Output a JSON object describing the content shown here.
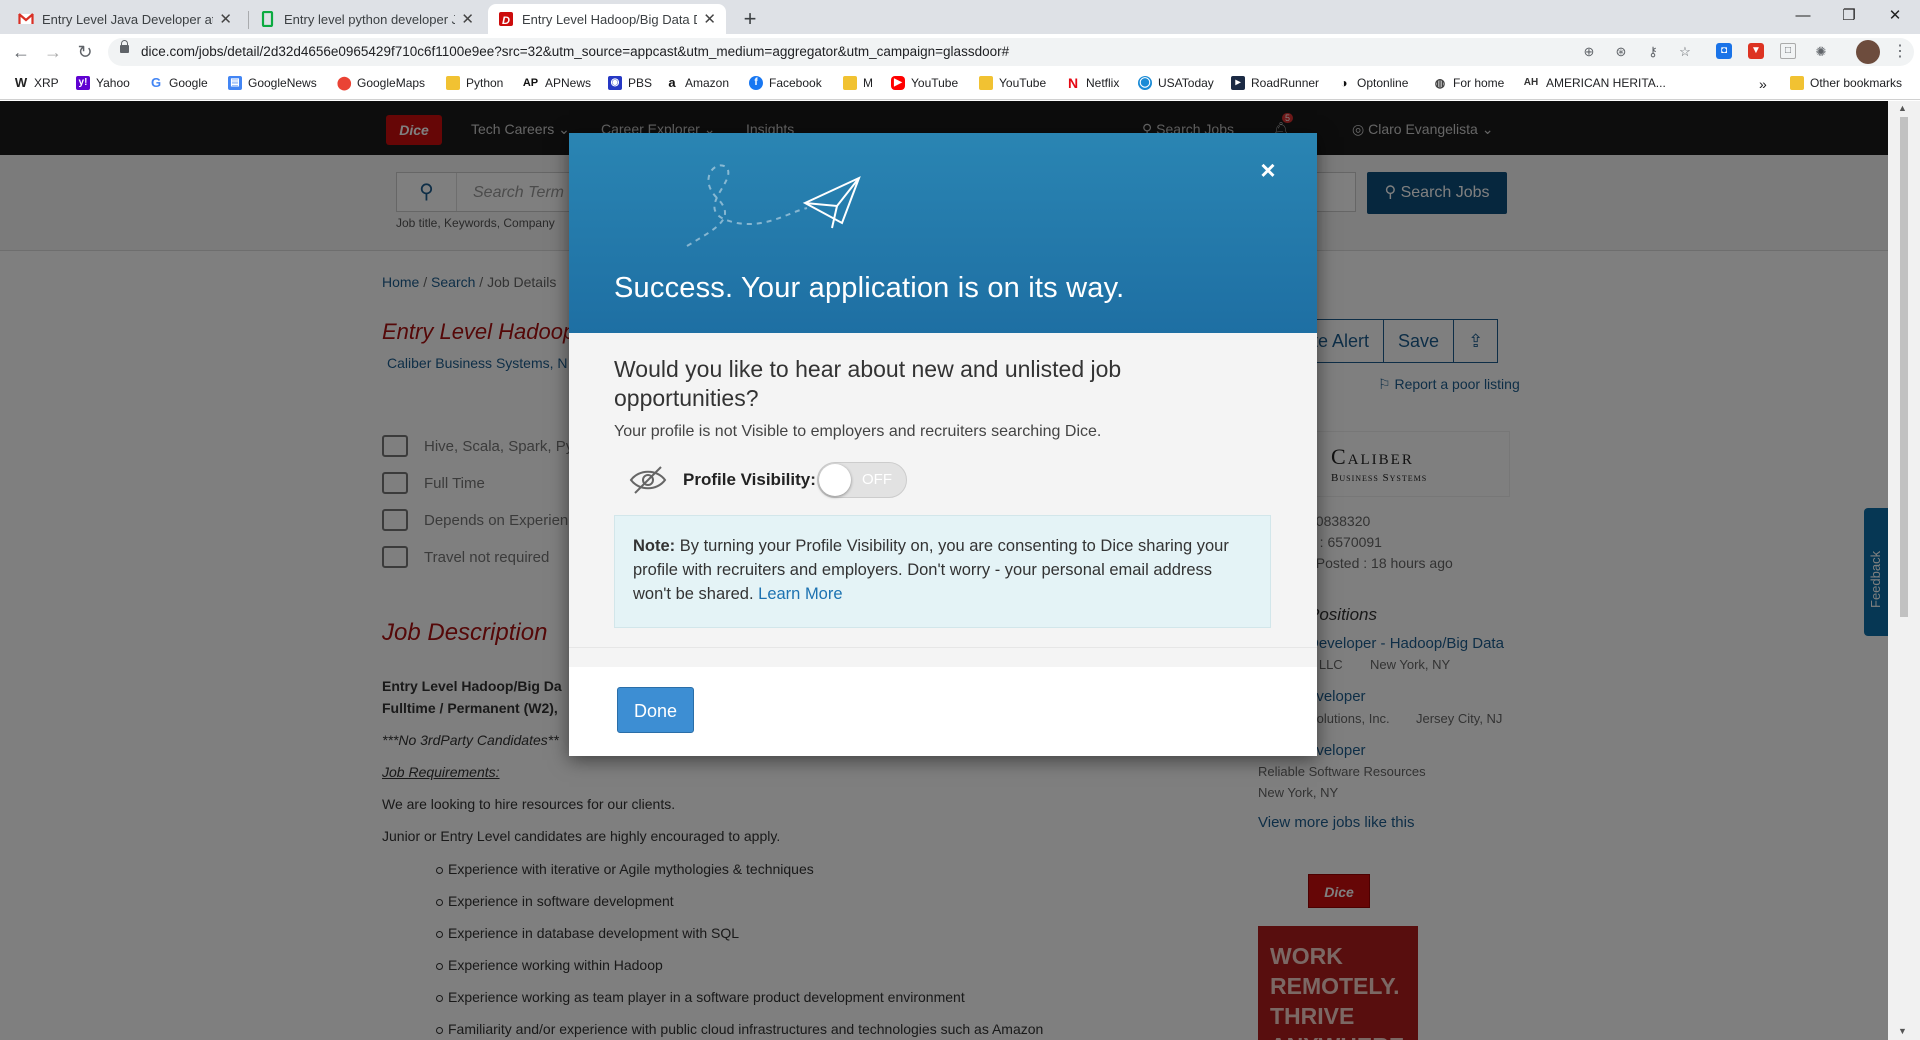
{
  "browser": {
    "tabs": [
      {
        "label": "Entry Level Java Developer at Syn",
        "icon": "gmail-icon",
        "active": false
      },
      {
        "label": "Entry level python developer Job",
        "icon": "glassdoor-icon",
        "active": false
      },
      {
        "label": "Entry Level Hadoop/Big Data De",
        "icon": "dice-icon",
        "active": true
      }
    ],
    "new_tab": "+",
    "url": "dice.com/jobs/detail/2d32d4656e0965429f710c6f1100e9ee?src=32&utm_source=appcast&utm_medium=aggregator&utm_campaign=glassdoor#",
    "bookmarks": [
      {
        "label": "XRP"
      },
      {
        "label": "Yahoo"
      },
      {
        "label": "Google"
      },
      {
        "label": "GoogleNews"
      },
      {
        "label": "GoogleMaps"
      },
      {
        "label": "Python"
      },
      {
        "label": "APNews"
      },
      {
        "label": "PBS"
      },
      {
        "label": "Amazon"
      },
      {
        "label": "Facebook"
      },
      {
        "label": "M"
      },
      {
        "label": "YouTube"
      },
      {
        "label": "YouTube"
      },
      {
        "label": "Netflix"
      },
      {
        "label": "USAToday"
      },
      {
        "label": "RoadRunner"
      },
      {
        "label": "Optonline"
      },
      {
        "label": "For home"
      },
      {
        "label": "AMERICAN HERITA..."
      }
    ],
    "more_bookmarks": "»",
    "other_bookmarks": "Other bookmarks"
  },
  "dice": {
    "logo": "Dice",
    "nav": [
      "Tech Careers",
      "Career Explorer",
      "Insights"
    ],
    "search_jobs_nav": "Search Jobs",
    "notification_count": "5",
    "user": "Claro Evangelista",
    "search_placeholder": "Search Term",
    "search_button": "Search Jobs",
    "search_hint": "Job title, Keywords, Company",
    "breadcrumb": {
      "home": "Home",
      "sep1": " / ",
      "search": "Search",
      "sep2": " / ",
      "current": "Job Details"
    },
    "job_title": "Entry Level Hadoop",
    "company": "Caliber Business Systems, N",
    "alert_btn": "te Alert",
    "save_btn": "Save",
    "poor_listing": "Report a poor listing",
    "details": [
      "Hive, Scala, Spark, Py",
      "Full Time",
      "Depends on Experien",
      "Travel not required"
    ],
    "job_description_title": "Job Description",
    "jd_lines": [
      "Entry Level Hadoop/Big Da",
      "Fulltime / Permanent (W2),",
      "***No 3rdParty Candidates**",
      "Job Requirements:",
      "We are looking to hire resources for our clients.",
      "Junior or Entry Level candidates are highly encouraged to apply."
    ],
    "bullets": [
      "Experience with iterative or Agile mythologies & techniques",
      "Experience in software development",
      "Experience in database development with SQL",
      "Experience working within Hadoop",
      "Experience working as team player in a software product development environment",
      "Familiarity and/or experience with public cloud infrastructures and technologies such as Amazon"
    ],
    "sidebar": {
      "logo_top": "Caliber",
      "logo_bottom": "Business Systems",
      "pos_id": "90838320",
      "dice_id": "d : 6570091",
      "posted": "/ Posted : 18 hours ago",
      "similar_title": "Positions",
      "similar": [
        {
          "title": "Developer - Hadoop/Big Data",
          "company": "t, LLC",
          "location": "New York, NY"
        },
        {
          "title": "eveloper",
          "company": "Solutions, Inc.",
          "location": "Jersey City, NJ"
        },
        {
          "title": "eveloper",
          "company": "Reliable Software Resources",
          "location": "New York, NY"
        }
      ],
      "view_more": "View more jobs like this",
      "ad_logo": "Dice",
      "ad_text": "WORK REMOTELY. THRIVE ANYWHERE"
    },
    "feedback": "Feedback"
  },
  "modal": {
    "title": "Success. Your application is on its way.",
    "close": "×",
    "question": "Would you like to hear about new and unlisted job opportunities?",
    "not_visible": "Your profile is not Visible to employers and recruiters searching Dice.",
    "visibility_label": "Profile Visibility:",
    "toggle_state": "OFF",
    "note_label": "Note:",
    "note_text": " By turning your Profile Visibility on, you are consenting to Dice sharing your profile with recruiters and employers. Don't worry - your personal email address won't be shared. ",
    "learn_more": "Learn More",
    "done": "Done"
  }
}
